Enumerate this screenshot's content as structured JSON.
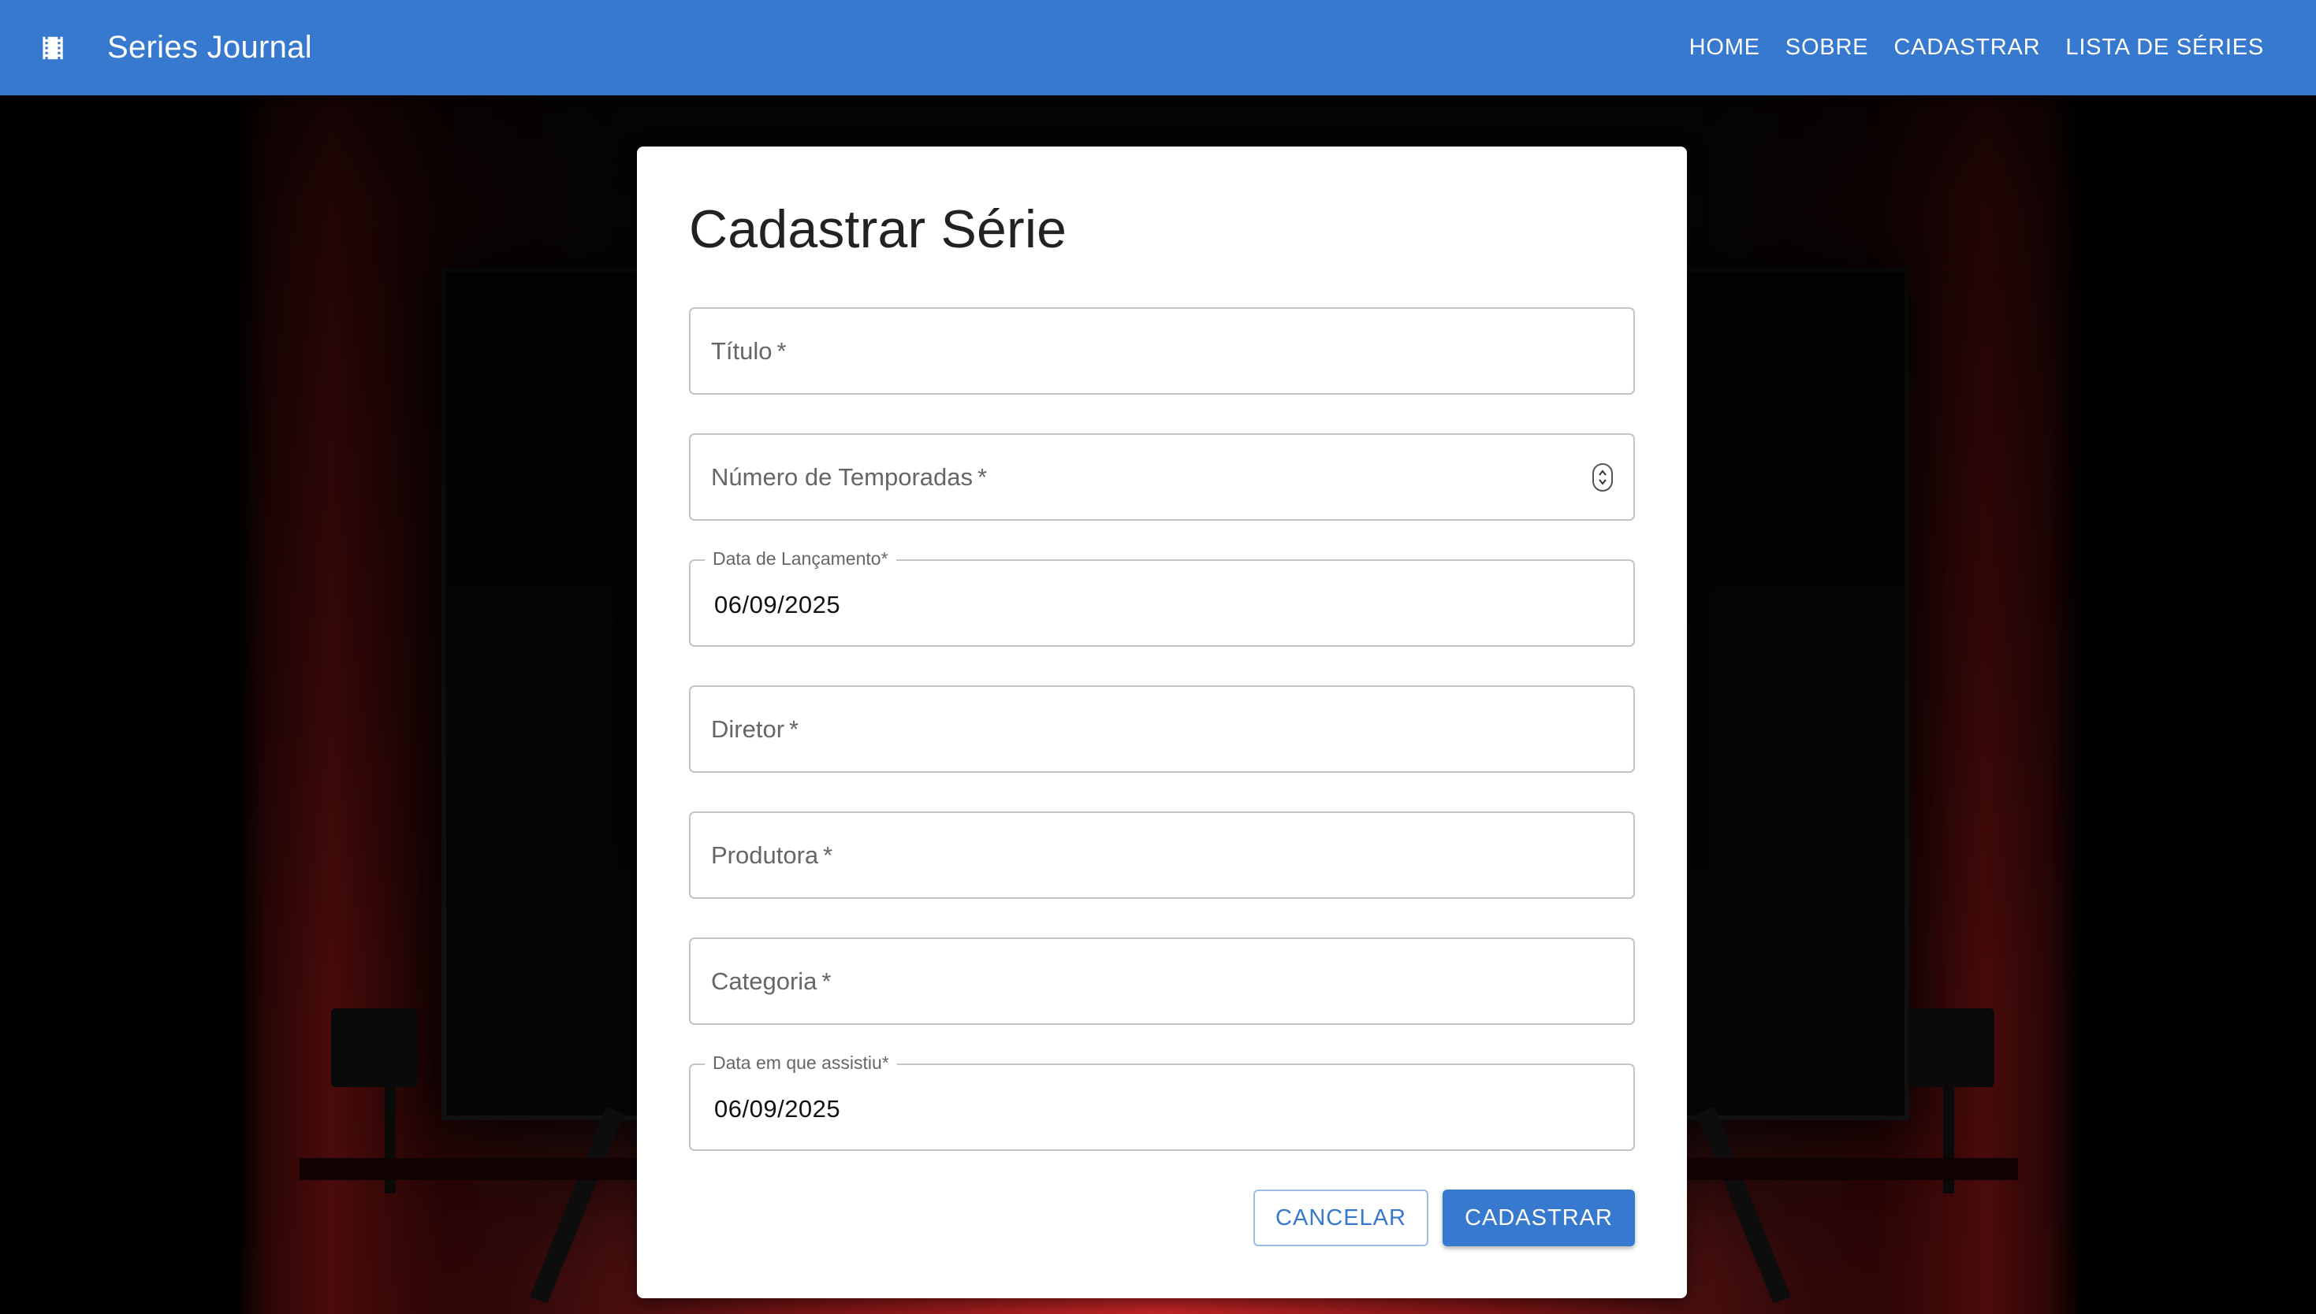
{
  "appbar": {
    "title": "Series Journal",
    "icon": "film-icon",
    "color": "#3679cf",
    "nav": [
      {
        "label": "HOME"
      },
      {
        "label": "SOBRE"
      },
      {
        "label": "CADASTRAR"
      },
      {
        "label": "LISTA DE SÉRIES"
      }
    ]
  },
  "form": {
    "title": "Cadastrar Série",
    "fields": {
      "titulo": {
        "label": "Título",
        "required": "*"
      },
      "temporadas": {
        "label": "Número de Temporadas",
        "required": "*"
      },
      "lancamento": {
        "label": "Data de Lançamento",
        "required": "*",
        "value": "06/09/2025"
      },
      "diretor": {
        "label": "Diretor",
        "required": "*"
      },
      "produtora": {
        "label": "Produtora",
        "required": "*"
      },
      "categoria": {
        "label": "Categoria",
        "required": "*"
      },
      "assistiu": {
        "label": "Data em que assistiu",
        "required": "*",
        "value": "06/09/2025"
      }
    },
    "cancel_label": "CANCELAR",
    "submit_label": "CADASTRAR"
  }
}
